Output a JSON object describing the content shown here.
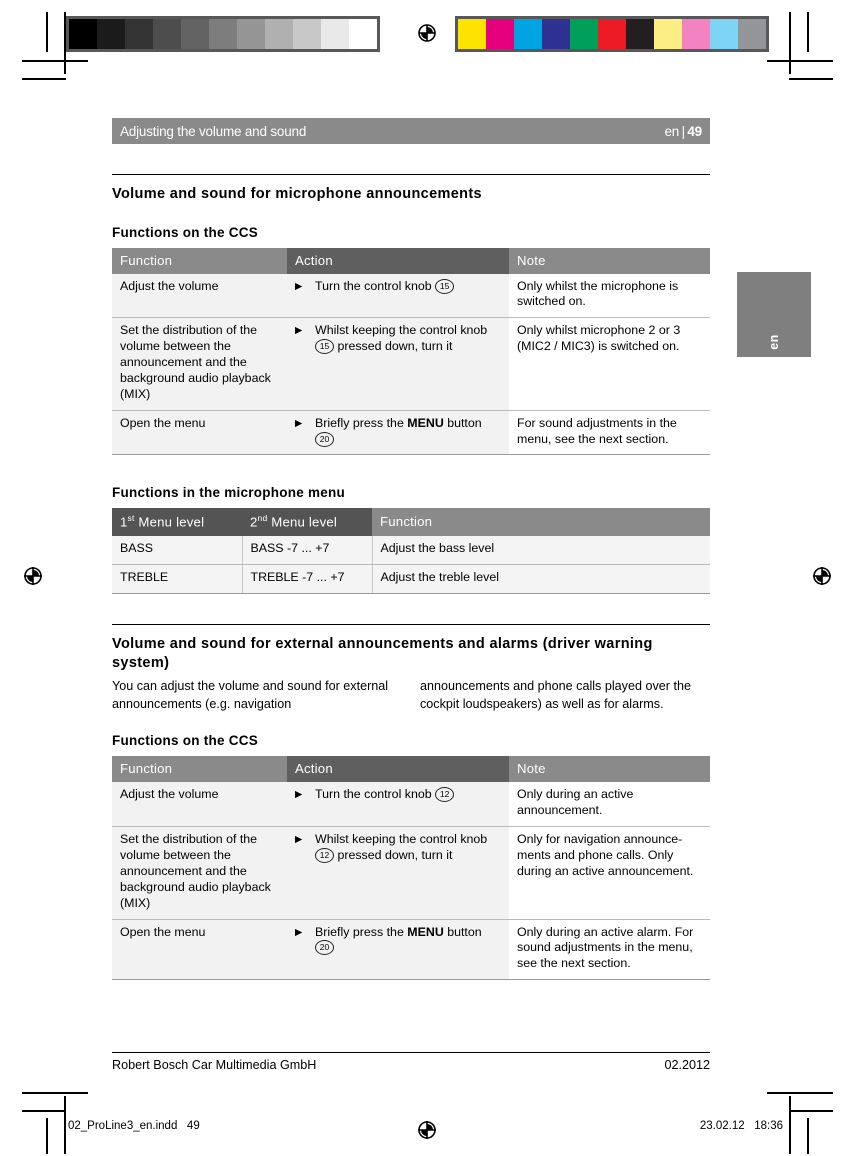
{
  "calibration": {
    "grayscale_swatches": [
      "#000000",
      "#1b1b1b",
      "#333333",
      "#4d4d4d",
      "#636363",
      "#7d7d7d",
      "#959595",
      "#b0b0b0",
      "#c8c8c8",
      "#e9e9e9",
      "#ffffff"
    ],
    "color_swatches": [
      "#fde400",
      "#e5017e",
      "#00a4e3",
      "#2e3191",
      "#00a css",
      "#ed1c24",
      "#231f20",
      "#fced84",
      "#f382c0",
      "#7ed4f5",
      "#939598"
    ],
    "color_swatches_fixed": [
      "#fde400",
      "#e5017e",
      "#00a4e3",
      "#2e3191",
      "#00a05a",
      "#ed1c24",
      "#231f20",
      "#fced84",
      "#f382c0",
      "#7ed4f5",
      "#939598"
    ],
    "strip_border_color": "#58585a"
  },
  "header": {
    "chapter_title": "Adjusting the volume and sound",
    "language": "en",
    "separator": "|",
    "page_number": "49",
    "bar_color": "#8a8a8a"
  },
  "thumb_tab": {
    "label": "en",
    "color": "#7f7f7f"
  },
  "section1": {
    "title": "Volume and sound for microphone announcements",
    "subtitle": "Functions on the CCS",
    "table": {
      "headers": [
        "Function",
        "Action",
        "Note"
      ],
      "rows": [
        {
          "function": "Adjust the volume",
          "action_prefix": "Turn the control knob ",
          "action_ref": "15",
          "action_suffix": "",
          "action_bold": "",
          "note": "Only whilst the microphone is switched on."
        },
        {
          "function": "Set the distribution of the volume between the announcement and the background audio playback (MIX)",
          "action_prefix": "Whilst keeping the control knob ",
          "action_ref": "15",
          "action_suffix": " pressed down, turn it",
          "action_bold": "",
          "note": "Only whilst microphone 2 or 3 (MIC2 / MIC3) is switched on."
        },
        {
          "function": "Open the menu",
          "action_prefix": "Briefly press the ",
          "action_bold": "MENU",
          "action_mid": " button ",
          "action_ref": "20",
          "action_suffix": "",
          "note": "For sound adjustments in the menu, see the next section."
        }
      ]
    }
  },
  "section2": {
    "subtitle": "Functions in the microphone menu",
    "table": {
      "headers": [
        {
          "text": "1",
          "sup": "st",
          "rest": " Menu level"
        },
        {
          "text": "2",
          "sup": "nd",
          "rest": " Menu level"
        },
        {
          "text": "Function",
          "sup": "",
          "rest": ""
        }
      ],
      "rows": [
        [
          "BASS",
          "BASS -7 ... +7",
          "Adjust the bass level"
        ],
        [
          "TREBLE",
          "TREBLE -7 ... +7",
          "Adjust the treble level"
        ]
      ]
    }
  },
  "section3": {
    "title": "Volume and sound for external announcements and alarms (driver warning system)",
    "paragraph_col1": "You can adjust the volume and sound for external announcements (e.g. navigation",
    "paragraph_col2": "announcements and phone calls played over the cockpit loudspeakers) as well as for alarms.",
    "subtitle": "Functions on the CCS",
    "table": {
      "headers": [
        "Function",
        "Action",
        "Note"
      ],
      "rows": [
        {
          "function": "Adjust the volume",
          "action_prefix": "Turn the control knob ",
          "action_ref": "12",
          "action_suffix": "",
          "action_bold": "",
          "note": "Only during an active announcement."
        },
        {
          "function": "Set the distribution of the volume between the announcement and the background audio playback (MIX)",
          "action_prefix": "Whilst keeping the control knob ",
          "action_ref": "12",
          "action_suffix": " pressed down, turn it",
          "action_bold": "",
          "note": "Only for navigation announce-ments and phone calls. Only during an active announcement."
        },
        {
          "function": "Open the menu",
          "action_prefix": "Briefly press the ",
          "action_bold": "MENU",
          "action_mid": " button ",
          "action_ref": "20",
          "action_suffix": "",
          "note": "Only during an active alarm. For sound adjustments in the menu, see the next section."
        }
      ]
    }
  },
  "footer": {
    "company": "Robert Bosch Car Multimedia GmbH",
    "date": "02.2012"
  },
  "slug": {
    "filename": "02_ProLine3_en.indd   49",
    "timestamp": "23.02.12   18:36"
  }
}
